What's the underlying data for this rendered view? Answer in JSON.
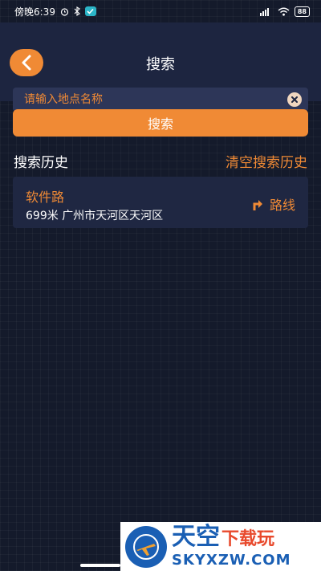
{
  "status_bar": {
    "time": "傍晚6:39",
    "battery": "88",
    "signal_label": "HD"
  },
  "header": {
    "title": "搜索",
    "search_placeholder": "请输入地点名称"
  },
  "search_button_label": "搜索",
  "history": {
    "title": "搜索历史",
    "clear_label": "清空搜索历史",
    "items": [
      {
        "name": "软件路",
        "distance": "699米",
        "address": "广州市天河区天河区",
        "route_label": "路线"
      }
    ]
  },
  "watermark": {
    "brand": "天空",
    "tagline": "下载玩",
    "url": "SKYXZW.COM"
  },
  "colors": {
    "accent": "#f08a35",
    "background": "#141a2b",
    "header": "#1d2540",
    "card": "#1f2742"
  },
  "icons": [
    "back-arrow-icon",
    "clear-icon",
    "route-icon",
    "bluetooth-icon",
    "wifi-icon",
    "signal-icon",
    "battery-icon"
  ]
}
